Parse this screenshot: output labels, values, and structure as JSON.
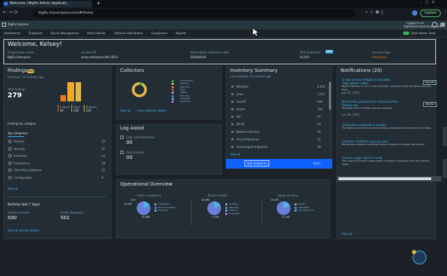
{
  "browser": {
    "tab_title": "Welcome | Bigfix Admin Applicati...",
    "new_tab": "+",
    "url": "bigfix.mycompany.com/#/home",
    "update_label": "Update"
  },
  "appbar": {
    "left_text": "BigFix Explorer",
    "right_line1": "Logged in as",
    "right_line2": "bigfixadmin@company.com"
  },
  "nav": {
    "items": [
      "Dashboards",
      "Endpoints",
      "Device Management",
      "Patch Policies",
      "Software Distribution",
      "Compliance",
      "Reports"
    ],
    "toggle_label": "Dark theme",
    "toggle_label2": "Help"
  },
  "welcome": {
    "title": "Welcome, Kelsey!",
    "fields": [
      {
        "label": "Organization name",
        "value": "BigFix Enterprise"
      },
      {
        "label": "Account ID",
        "value": "acme-enterprise-001-4521"
      },
      {
        "label": "Subscription expiration date",
        "value": "2026/06/30"
      },
      {
        "label": "Total Endpoints",
        "value": "14,503",
        "badge": "NEW"
      },
      {
        "label": "Account Type",
        "value": "Production"
      }
    ]
  },
  "findings": {
    "title": "Findings",
    "badge": "New",
    "subtitle": "Last scan: 12 minutes ago",
    "total_label": "Total findings",
    "total": "279",
    "legend": [
      {
        "label": "Critical",
        "value": "39"
      },
      {
        "label": "High",
        "value": "120"
      },
      {
        "label": "Medium",
        "value": "120"
      }
    ],
    "section_label": "Findings by category",
    "section_sub": "Top categories",
    "list": [
      {
        "label": "Patches",
        "value": "43"
      },
      {
        "label": "Security",
        "value": "31"
      },
      {
        "label": "Inventory",
        "value": "24"
      },
      {
        "label": "Compliance",
        "value": "18"
      },
      {
        "label": "Third Party Software",
        "value": "12"
      },
      {
        "label": "Configuration",
        "value": "8"
      }
    ],
    "view_all": "View all",
    "activity_title": "Activity last 7 days",
    "activity_cols": [
      {
        "label": "Actions Created",
        "value": "500"
      },
      {
        "label": "Fixlets Deployed",
        "value": "501"
      }
    ],
    "view_details": "View all activity details"
  },
  "collectors": {
    "title": "Collectors",
    "legend": [
      "Connected",
      "Healthy",
      "Warning",
      "Error",
      "Offline",
      "Pending",
      "Disabled",
      "Unknown"
    ],
    "view_all": "View all",
    "view_all2": "View collector details"
  },
  "log_assist": {
    "title": "Log Assist",
    "rows": [
      {
        "label": "Logs collected today",
        "value": "00"
      },
      {
        "label": "Alerts raised",
        "value": "00"
      }
    ]
  },
  "inventory": {
    "title": "Inventory Summary",
    "subtitle": "Last updated: 10 minutes ago",
    "rows": [
      {
        "label": "Windows",
        "value": "2,914"
      },
      {
        "label": "Linux",
        "value": "1,221"
      },
      {
        "label": "macOS",
        "value": "624"
      },
      {
        "label": "Solaris",
        "value": "118"
      },
      {
        "label": "AIX",
        "value": "97"
      },
      {
        "label": "HP-UX",
        "value": "44"
      },
      {
        "label": "Network Devices",
        "value": "36"
      },
      {
        "label": "Virtual Machines",
        "value": "22"
      },
      {
        "label": "Unmanaged Endpoints",
        "value": "18"
      }
    ],
    "view_all": "View all",
    "action_label": "Add endpoints",
    "action_right": "Open"
  },
  "notifications": {
    "title": "Notifications (20)",
    "items": [
      {
        "title": "A new version of BigFix is available",
        "link": "View release notes",
        "body": "BigFix Platform 11.0.3 is now available. Upgrade to get the latest security fixes.",
        "time": "Jun 20, 2025",
        "button": "Upgrade"
      },
      {
        "title": "New Fixlets published for critical patches",
        "link": "Review now",
        "body": "Microsoft Patch Tuesday content available.",
        "time": "Jun 18, 2025",
        "button": "Review"
      },
      {
        "title": "Scheduled maintenance window",
        "link": "",
        "body": "The BigFix cloud services will undergo scheduled maintenance on Sunday.",
        "time": "",
        "button": ""
      },
      {
        "title": "Collector certificate expiring soon",
        "link": "",
        "body": "Renew the collector certificate before it expires to avoid interruption.",
        "time": "",
        "button": ""
      },
      {
        "title": "License usage report is ready",
        "link": "",
        "body": "Your monthly license usage report is ready to download from the reports page.",
        "time": "",
        "button": ""
      }
    ],
    "view_all": "View all"
  },
  "operational": {
    "title": "Operational Overview",
    "charts": [
      {
        "title": "Patch compliance",
        "left": "13,045",
        "top": "21%",
        "bottom": "10,388",
        "legend": [
          "Compliant",
          "Non-compliant",
          "Pending"
        ]
      },
      {
        "title": "Device health",
        "left": "",
        "top": "10,560",
        "bottom": "1,290",
        "legend": [
          "Healthy",
          "Warning",
          "Critical",
          "Unknown"
        ]
      },
      {
        "title": "Agent versions",
        "left": "",
        "top": "13,025",
        "bottom": "11,445",
        "legend": [
          "Latest",
          "Outdated",
          "Unsupported"
        ]
      }
    ]
  },
  "colors": {
    "accent": "#4fb3e8",
    "critical": "#f07c1c",
    "high": "#f5a623",
    "medium": "#e0b84a",
    "pie": "#6a7fd8",
    "primary_button": "#0f62fe"
  },
  "chart_data": [
    {
      "type": "bar",
      "categories": [
        "Critical",
        "High",
        "Medium"
      ],
      "series": [
        {
          "name": "Findings",
          "values": [
            39,
            120,
            120
          ]
        }
      ],
      "ylim": [
        0,
        120
      ]
    }
  ]
}
